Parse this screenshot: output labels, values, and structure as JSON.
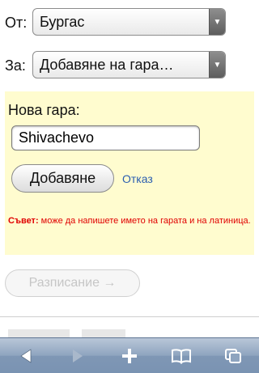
{
  "form": {
    "from_label": "От:",
    "from_value": "Бургас",
    "to_label": "За:",
    "to_value": "Добавяне на гара…"
  },
  "add_station": {
    "title": "Нова гара:",
    "input_value": "Shivachevo",
    "add_label": "Добавяне",
    "cancel_label": "Отказ",
    "tip_prefix": "Съвет:",
    "tip_text": " може да напишете името на гарата и на латиница."
  },
  "schedule_label": "Разписание →",
  "toolbar": {
    "back_icon": "back-arrow-icon",
    "forward_icon": "forward-arrow-icon",
    "add_icon": "plus-icon",
    "bookmarks_icon": "book-icon",
    "pages_icon": "pages-icon"
  },
  "colors": {
    "panel_bg": "#fffccf",
    "tip": "#e00000",
    "link": "#2a5db0",
    "toolbar": "#8ea4bf"
  }
}
